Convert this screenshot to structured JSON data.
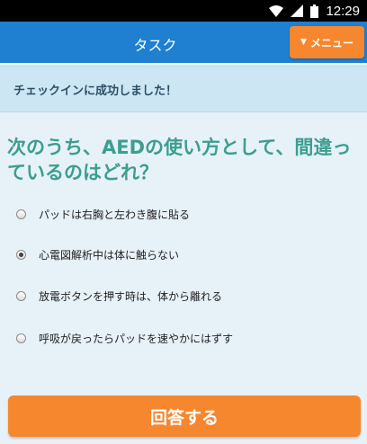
{
  "status_bar": {
    "time": "12:29"
  },
  "header": {
    "title": "タスク",
    "menu_label": "メニュー"
  },
  "banner": {
    "message": "チェックインに成功しました！"
  },
  "quiz": {
    "question": "次のうち、AEDの使い方として、間違っているのはどれ？",
    "options": [
      {
        "label": "パッドは右胸と左わき腹に貼る",
        "selected": false
      },
      {
        "label": "心電図解析中は体に触らない",
        "selected": true
      },
      {
        "label": "放電ボタンを押す時は、体から離れる",
        "selected": false
      },
      {
        "label": "呼吸が戻ったらパッドを速やかにはずす",
        "selected": false
      }
    ],
    "submit_label": "回答する"
  },
  "colors": {
    "header": "#1f7fd1",
    "accent": "#f7872f",
    "question_text": "#3c9e8f",
    "banner_bg": "#cde6f4",
    "page_bg": "#e7f1f8"
  },
  "icons": [
    "wifi-icon",
    "signal-icon",
    "battery-icon",
    "caret-down-icon"
  ]
}
